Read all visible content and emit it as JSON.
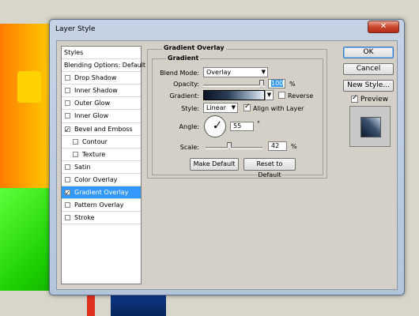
{
  "window": {
    "title": "Layer Style",
    "close_glyph": "✕"
  },
  "styles_list": {
    "items": [
      {
        "label": "Styles",
        "kind": "header",
        "checked": false
      },
      {
        "label": "Blending Options: Default",
        "kind": "header",
        "checked": false
      },
      {
        "label": "Drop Shadow",
        "kind": "checkable",
        "checked": false
      },
      {
        "label": "Inner Shadow",
        "kind": "checkable",
        "checked": false
      },
      {
        "label": "Outer Glow",
        "kind": "checkable",
        "checked": false
      },
      {
        "label": "Inner Glow",
        "kind": "checkable",
        "checked": false
      },
      {
        "label": "Bevel and Emboss",
        "kind": "checkable",
        "checked": true
      },
      {
        "label": "Contour",
        "kind": "indented",
        "checked": false
      },
      {
        "label": "Texture",
        "kind": "indented",
        "checked": false
      },
      {
        "label": "Satin",
        "kind": "checkable",
        "checked": false
      },
      {
        "label": "Color Overlay",
        "kind": "checkable",
        "checked": false
      },
      {
        "label": "Gradient Overlay",
        "kind": "checkable",
        "checked": true,
        "selected": true
      },
      {
        "label": "Pattern Overlay",
        "kind": "checkable",
        "checked": false
      },
      {
        "label": "Stroke",
        "kind": "checkable",
        "checked": false
      }
    ]
  },
  "panel": {
    "section_title": "Gradient Overlay",
    "group_title": "Gradient",
    "blend_mode_label": "Blend Mode:",
    "blend_mode_value": "Overlay",
    "opacity_label": "Opacity:",
    "opacity_value": "100",
    "opacity_fraction": 1.0,
    "percent": "%",
    "gradient_label": "Gradient:",
    "reverse_label": "Reverse",
    "reverse_checked": false,
    "style_label": "Style:",
    "style_value": "Linear",
    "align_label": "Align with Layer",
    "align_checked": true,
    "angle_label": "Angle:",
    "angle_value": "55",
    "degree": "°",
    "scale_label": "Scale:",
    "scale_value": "42",
    "scale_fraction": 0.42,
    "make_default_label": "Make Default",
    "reset_default_label": "Reset to Default"
  },
  "side": {
    "ok_label": "OK",
    "cancel_label": "Cancel",
    "new_style_label": "New Style...",
    "preview_label": "Preview",
    "preview_checked": true
  }
}
